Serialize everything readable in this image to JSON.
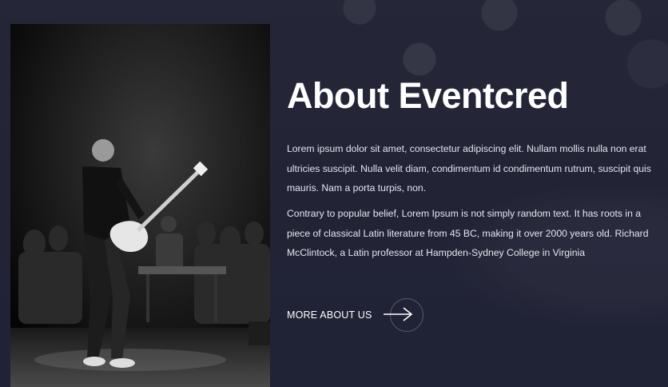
{
  "about": {
    "title": "About Eventcred",
    "paragraph_1": "Lorem ipsum dolor sit amet, consectetur adipiscing elit. Nullam mollis nulla non erat ultricies suscipit. Nulla velit diam, condimentum id condimentum rutrum, suscipit quis mauris. Nam a porta turpis, non.",
    "paragraph_2": "Contrary to popular belief, Lorem Ipsum is not simply random text. It has roots in a piece of classical Latin literature from 45 BC, making it over 2000 years old. Richard McClintock, a Latin professor at Hampden-Sydney College in Virginia",
    "more_label": "MORE ABOUT US",
    "more_icon": "arrow-right-icon",
    "photo": "guitarist-on-stage-image"
  },
  "colors": {
    "background": "#262838",
    "text": "#ffffff"
  }
}
